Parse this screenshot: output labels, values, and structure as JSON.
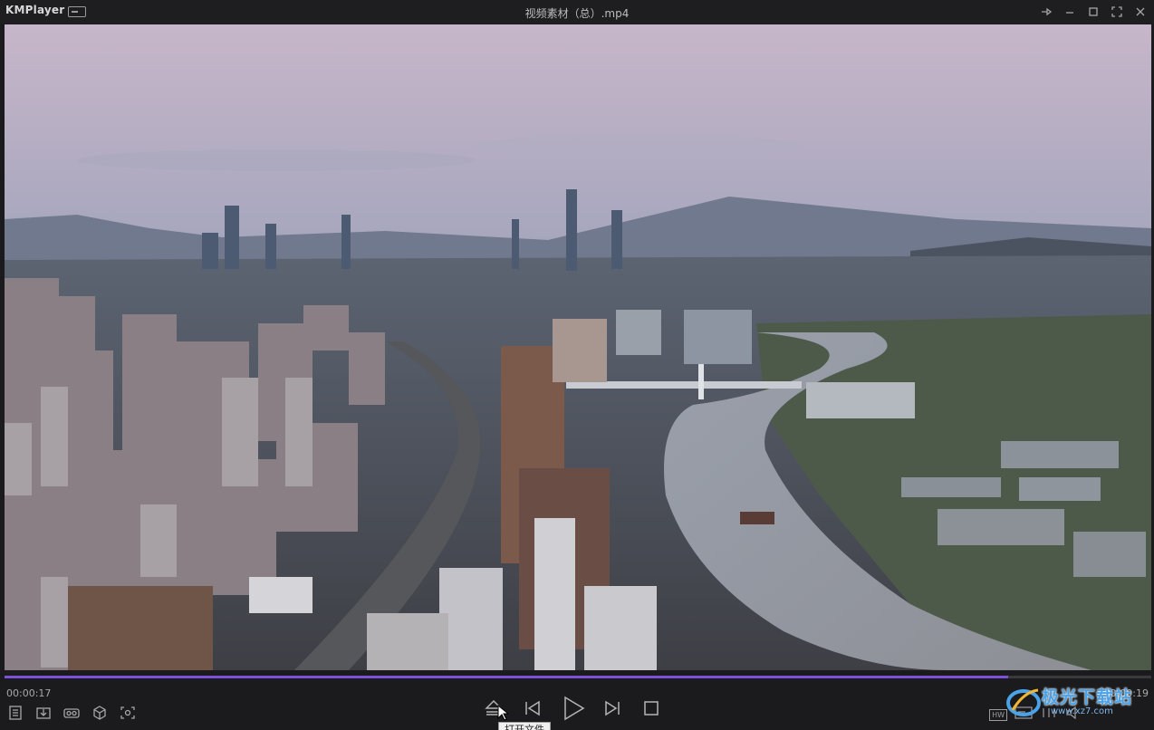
{
  "app": {
    "brand": "KMPlayer",
    "title": "视频素材（总）.mp4"
  },
  "window_controls": [
    "pin-icon",
    "minimize-icon",
    "maximize-icon",
    "fullscreen-icon",
    "close-icon"
  ],
  "playback": {
    "elapsed": "00:00:17",
    "total": "00:00:19",
    "progress": 0.875,
    "tooltip": "打开文件"
  },
  "left_tools": [
    "playlist-icon",
    "download-icon",
    "vr-icon",
    "3d-cube-icon",
    "capture-icon"
  ],
  "center_controls": [
    "eject-open-icon",
    "previous-icon",
    "play-icon",
    "next-icon",
    "stop-icon"
  ],
  "right_tools": {
    "hw_label": "HW"
  },
  "watermark": {
    "text": "极光下载站",
    "url": "www.xz7.com"
  },
  "colors": {
    "accent": "#7b52d9",
    "background": "#1b1b1d",
    "watermark": "#4aa3e8"
  }
}
